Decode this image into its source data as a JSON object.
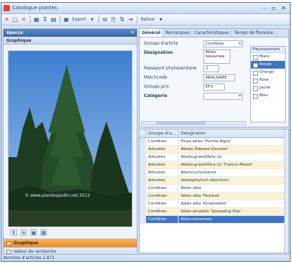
{
  "window": {
    "title": "Catalogue plantes",
    "controls": {
      "minimize": "–",
      "maximize": "▫",
      "close": "✕"
    }
  },
  "toolbar": {
    "items": [
      {
        "icon": "close-icon",
        "glyph": "✕"
      },
      {
        "icon": "new-icon",
        "glyph": "▢"
      },
      {
        "icon": "delete-icon",
        "glyph": "✕"
      },
      {
        "icon": "grid-icon",
        "glyph": "▦"
      },
      {
        "icon": "filter-icon",
        "glyph": "⊽"
      },
      {
        "icon": "print-icon",
        "glyph": "▤"
      }
    ],
    "export_label": "Export",
    "back_label": "Retour"
  },
  "left_panel": {
    "header": "Aperçu",
    "section": "Graphique",
    "watermark": "© www.plantesjardin.net 2012",
    "tabs": {
      "active": "Graphique",
      "inactive": "Valeur de recherche"
    }
  },
  "form": {
    "tabs": [
      "Général",
      "Remarques",
      "Caractéristiques",
      "Temps de floraison"
    ],
    "fields": [
      {
        "label": "Groupe d'article",
        "value": "Conifères",
        "kind": "select"
      },
      {
        "label": "Désignation",
        "value": "Abies balsamea",
        "kind": "multiline"
      },
      {
        "label": "Passeport phytosanitaire",
        "value": "2",
        "kind": "small"
      },
      {
        "label": "Matchcode",
        "value": "ABALSAME",
        "kind": "wide"
      },
      {
        "label": "Groupe prix",
        "value": "EF.0",
        "kind": "medium"
      },
      {
        "label": "Catégorie",
        "value": "",
        "kind": "select"
      }
    ],
    "color_list_header": "Fleurissement",
    "color_items": [
      "Blanc",
      "Rouge",
      "Orange",
      "Rose",
      "Jaune",
      "Bleu"
    ],
    "color_selected_index": 1
  },
  "grid": {
    "columns": [
      "Groupe d'a...",
      "Désignation"
    ],
    "rows": [
      {
        "group": "Conifères",
        "designation": "Picea abies 'Pumila Nigra'"
      },
      {
        "group": "Arbustes",
        "designation": "Abelia 'Edward Goucher'"
      },
      {
        "group": "Arbustes",
        "designation": "Abelia grandiflora (s)"
      },
      {
        "group": "Arbustes",
        "designation": "Abelia grandiflora (s) 'Francis Mason'"
      },
      {
        "group": "Arbustes",
        "designation": "Abelia schumannii"
      },
      {
        "group": "Arbustes",
        "designation": "Abeliophyllum distichum"
      },
      {
        "group": "Conifères",
        "designation": "Abies alba"
      },
      {
        "group": "Conifères",
        "designation": "Abies alba 'Pendula'"
      },
      {
        "group": "Conifères",
        "designation": "Abies alba 'Pyramidalis'"
      },
      {
        "group": "Conifères",
        "designation": "Abies amabilis 'Spreading Star'"
      },
      {
        "group": "Conifères",
        "designation": "Abies balsamea"
      }
    ],
    "selected_index": 10
  },
  "status": {
    "text": "Nombre d'articles 1.871"
  },
  "colors": {
    "accent": "#3d74c9",
    "active_tab": "#f08a1a",
    "panel_header": "#4a78ba",
    "alt_row": "#fbf3d3"
  }
}
